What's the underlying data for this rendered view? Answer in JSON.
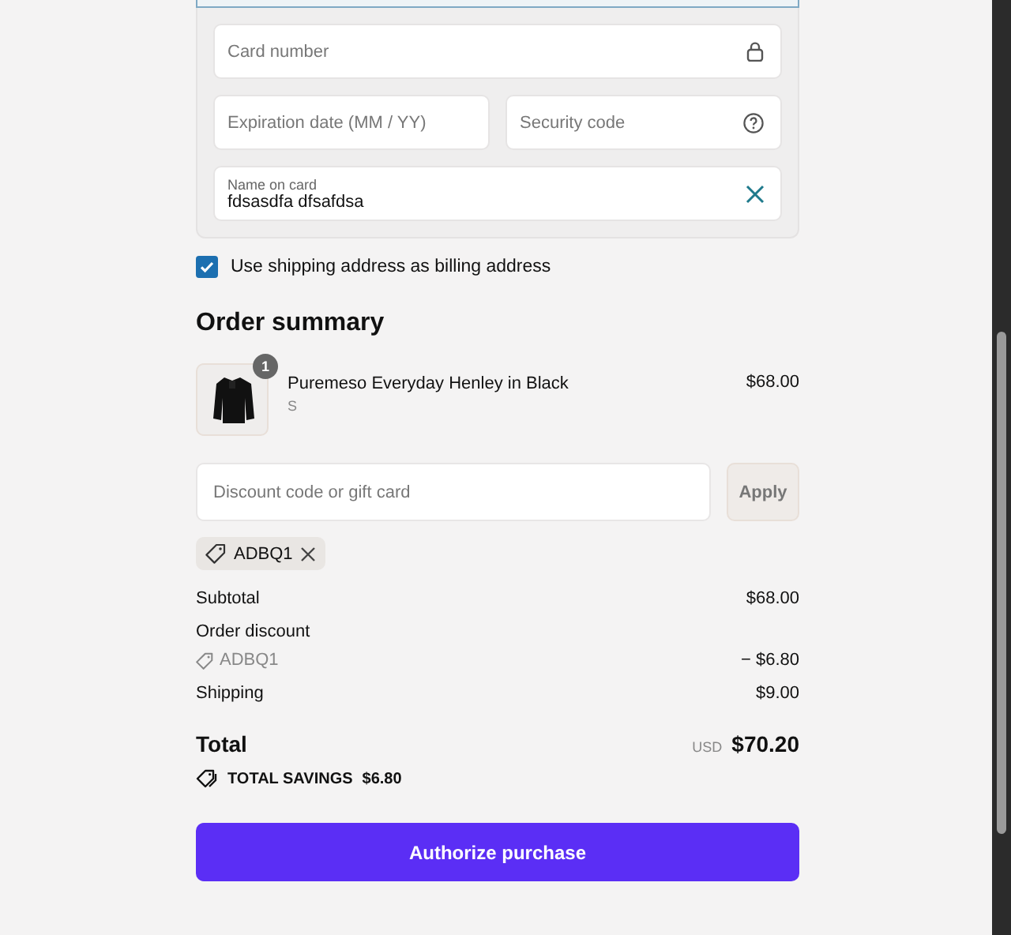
{
  "card_form": {
    "card_number": {
      "placeholder": "Card number"
    },
    "expiration": {
      "placeholder": "Expiration date (MM / YY)"
    },
    "security_code": {
      "placeholder": "Security code"
    },
    "name_on_card": {
      "label": "Name on card",
      "value": "fdsasdfa dfsafdsa"
    }
  },
  "billing_same": {
    "label": "Use shipping address as billing address",
    "checked": true
  },
  "order_summary": {
    "title": "Order summary",
    "items": [
      {
        "name": "Puremeso Everyday Henley in Black",
        "variant": "S",
        "quantity": "1",
        "price": "$68.00"
      }
    ],
    "discount": {
      "placeholder": "Discount code or gift card",
      "button": "Apply",
      "applied_code": "ADBQ1"
    },
    "lines": [
      {
        "kind": "plain",
        "label": "Subtotal",
        "value": "$68.00"
      },
      {
        "kind": "discount",
        "label": "Order discount",
        "code": "ADBQ1",
        "value": "− $6.80"
      },
      {
        "kind": "plain",
        "label": "Shipping",
        "value": "$9.00"
      }
    ],
    "total": {
      "label": "Total",
      "currency": "USD",
      "value": "$70.20"
    },
    "savings": {
      "label": "TOTAL SAVINGS",
      "value": "$6.80"
    },
    "button": "Authorize purchase"
  }
}
